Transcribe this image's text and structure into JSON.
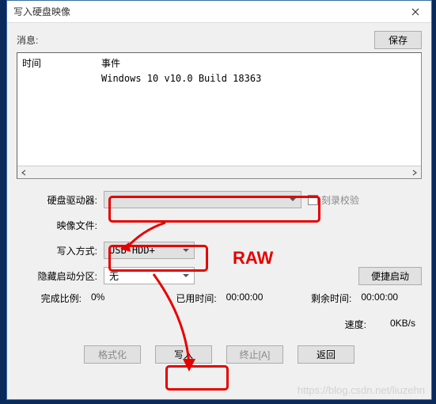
{
  "window": {
    "title": "写入硬盘映像"
  },
  "buttons": {
    "save": "保存",
    "easy_boot": "便捷启动",
    "format": "格式化",
    "write": "写入",
    "abort": "终止[A]",
    "back": "返回"
  },
  "labels": {
    "info": "消息:",
    "time_col": "时间",
    "event_col": "事件",
    "drive": "硬盘驱动器:",
    "image": "映像文件:",
    "method": "写入方式:",
    "hidden": "隐藏启动分区:",
    "verify": "刻录校验",
    "done": "完成比例:",
    "elapsed": "已用时间:",
    "remain": "剩余时间:",
    "speed": "速度:"
  },
  "log": [
    {
      "time": "",
      "event": "Windows 10 v10.0 Build 18363"
    }
  ],
  "fields": {
    "drive": "",
    "image": "",
    "method": "USB-HDD+",
    "hidden": "无"
  },
  "stats": {
    "done": "0%",
    "elapsed": "00:00:00",
    "remain": "00:00:00",
    "speed": "0KB/s"
  },
  "annotation": {
    "raw": "RAW"
  },
  "watermark": "https://blog.csdn.net/liuzehn"
}
